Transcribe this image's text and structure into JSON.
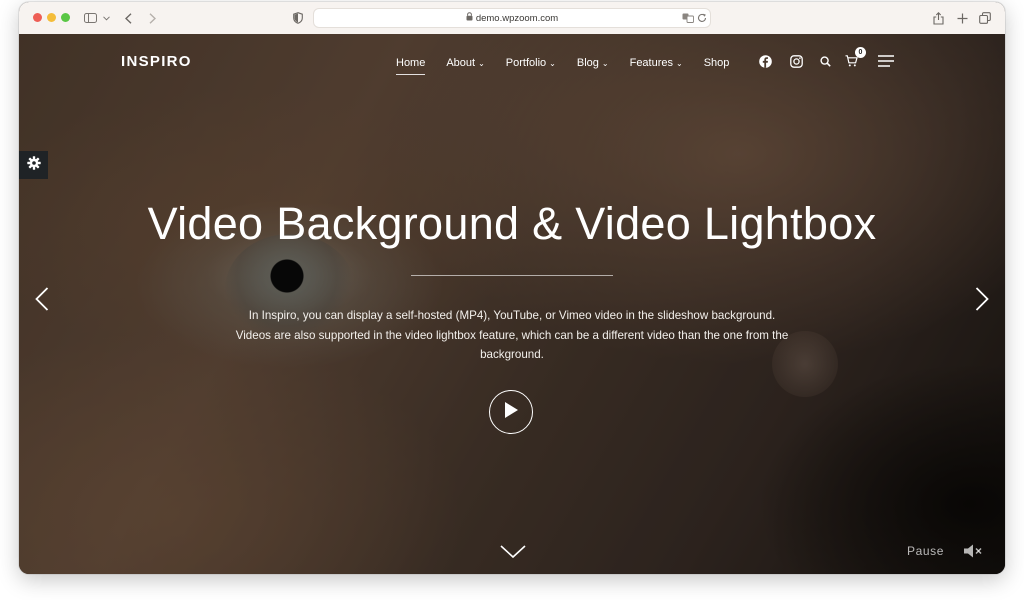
{
  "browser": {
    "url": "demo.wpzoom.com",
    "icons": [
      "sidebar-icon",
      "chevron-left-icon",
      "chevron-right-icon",
      "shield-icon",
      "translate-icon",
      "reload-icon",
      "share-icon",
      "new-tab-icon",
      "tabs-overview-icon"
    ]
  },
  "site": {
    "logo": "INSPIRO",
    "nav": [
      {
        "label": "Home",
        "active": true,
        "dropdown": false
      },
      {
        "label": "About",
        "dropdown": true
      },
      {
        "label": "Portfolio",
        "dropdown": true
      },
      {
        "label": "Blog",
        "dropdown": true
      },
      {
        "label": "Features",
        "dropdown": true
      },
      {
        "label": "Shop",
        "dropdown": false
      }
    ],
    "caret": "⌄",
    "cart_count": "0"
  },
  "hero": {
    "title": "Video Background & Video Lightbox",
    "description_lines": [
      "In Inspiro, you can display a self-hosted (MP4), YouTube, or Vimeo video in the slideshow background.",
      "Videos are also supported in the video lightbox feature, which can be a different video than the one from the",
      "background."
    ],
    "pause_label": "Pause"
  },
  "colors": {
    "chrome_bg": "#f7f3f0",
    "settings_tab": "#1f2326",
    "text": "#ffffff"
  }
}
